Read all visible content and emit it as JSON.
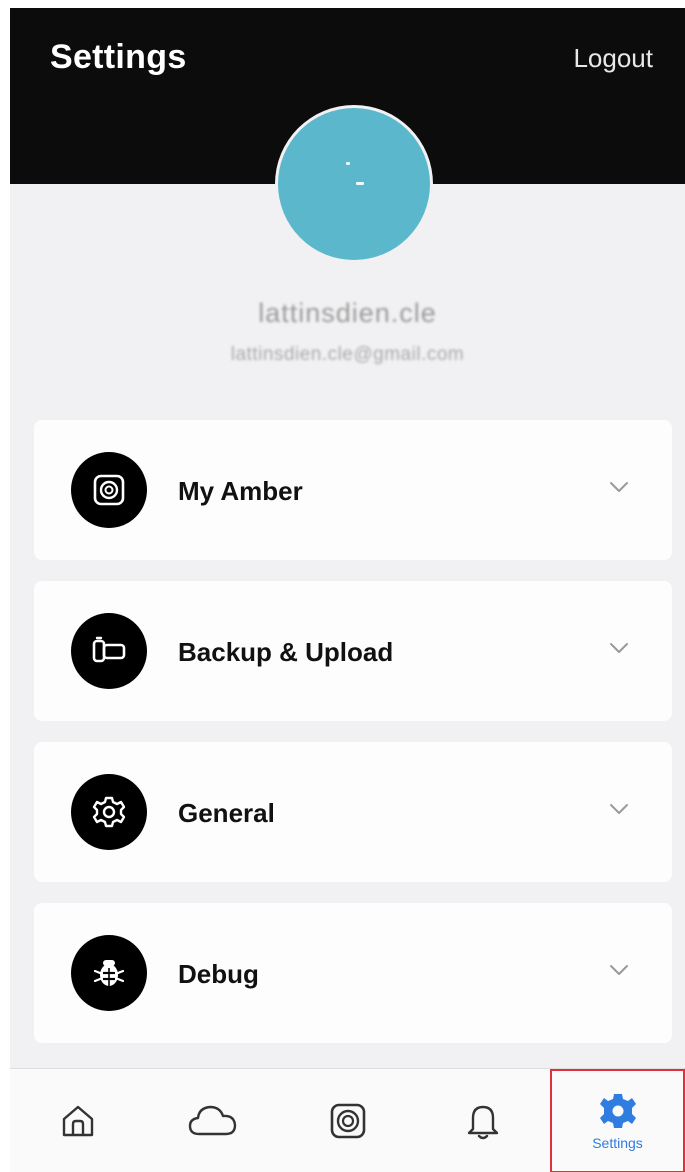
{
  "header": {
    "title": "Settings",
    "logout_label": "Logout"
  },
  "profile": {
    "name": "lattinsdien.cle",
    "email": "lattinsdien.cle@gmail.com"
  },
  "menu": [
    {
      "label": "My Amber",
      "icon": "amber-device-icon"
    },
    {
      "label": "Backup & Upload",
      "icon": "backup-icon"
    },
    {
      "label": "General",
      "icon": "gear-icon"
    },
    {
      "label": "Debug",
      "icon": "bug-icon"
    }
  ],
  "tabbar": {
    "tabs": [
      {
        "name": "home",
        "icon": "home-icon"
      },
      {
        "name": "cloud",
        "icon": "cloud-icon"
      },
      {
        "name": "device",
        "icon": "amber-device-icon"
      },
      {
        "name": "notifications",
        "icon": "bell-icon"
      },
      {
        "name": "settings",
        "icon": "gear-icon",
        "label": "Settings",
        "active": true
      }
    ]
  },
  "colors": {
    "active_tab": "#2f7de1",
    "avatar": "#5bb8cc",
    "highlight": "#e0303c"
  }
}
